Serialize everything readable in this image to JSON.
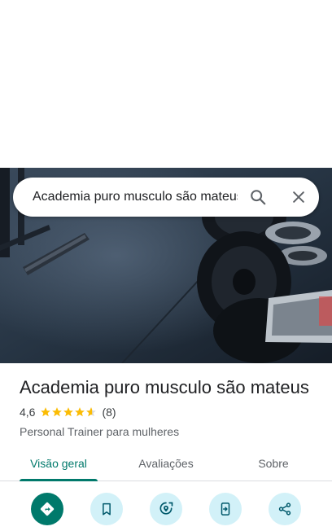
{
  "search": {
    "query": "Academia puro musculo são mateus"
  },
  "place": {
    "name": "Academia puro musculo são mateus",
    "rating": "4,6",
    "rating_value": 4.6,
    "review_count": "(8)",
    "category": "Personal Trainer para mulheres"
  },
  "tabs": [
    {
      "label": "Visão geral",
      "active": true
    },
    {
      "label": "Avaliações",
      "active": false
    },
    {
      "label": "Sobre",
      "active": false
    }
  ],
  "actions": [
    {
      "icon": "directions-icon"
    },
    {
      "icon": "bookmark-icon"
    },
    {
      "icon": "nearby-icon"
    },
    {
      "icon": "send-to-phone-icon"
    },
    {
      "icon": "share-icon"
    }
  ],
  "colors": {
    "accent": "#00796b",
    "action_bg": "#d2f1f8",
    "star": "#fbbc04"
  }
}
